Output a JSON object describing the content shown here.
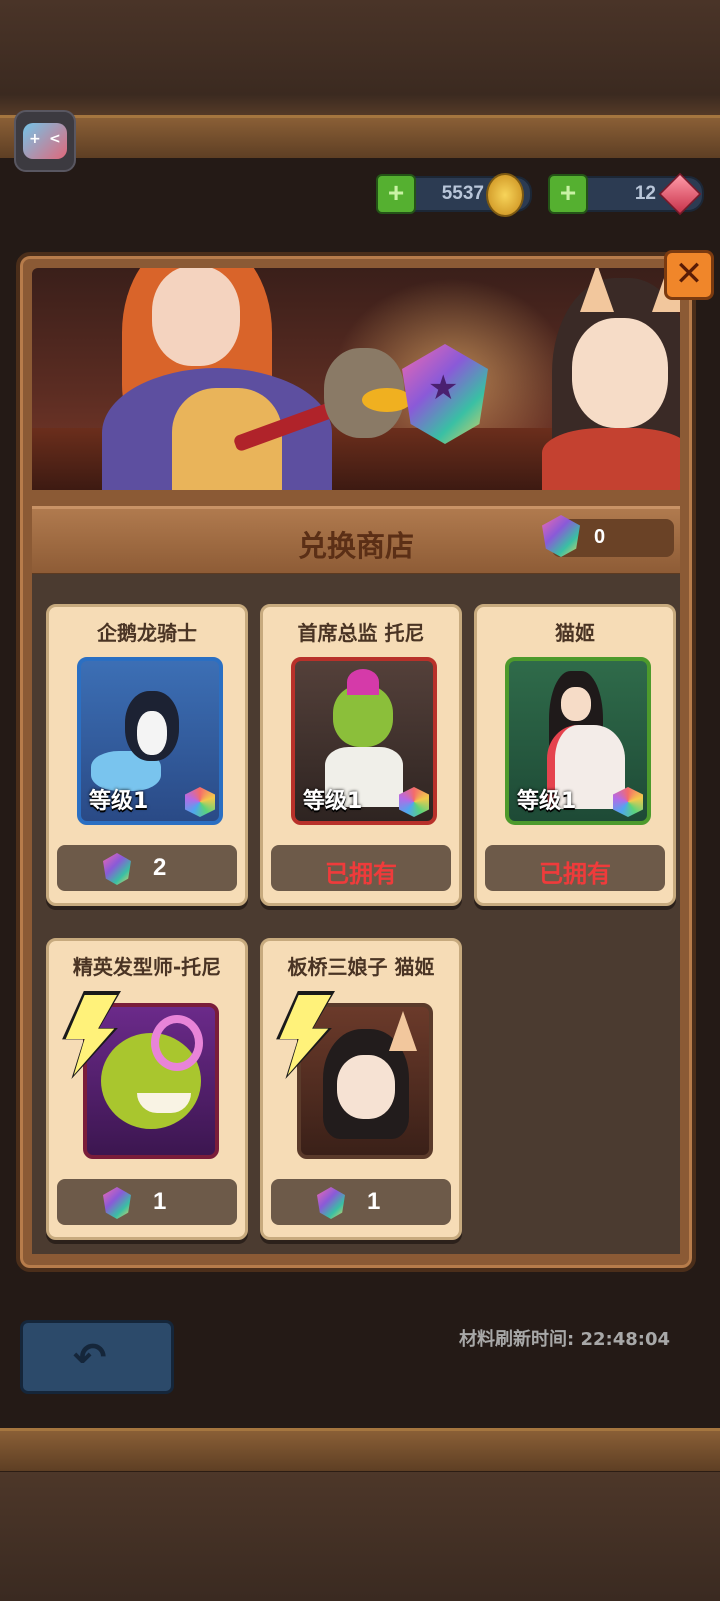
{
  "currency": {
    "gold": "5537",
    "gems": "12"
  },
  "shop": {
    "title": "兑换商店",
    "token_balance": "0"
  },
  "items": [
    {
      "name": "企鹅龙骑士",
      "level": "等级1",
      "cost": "2",
      "owned_label": ""
    },
    {
      "name": "首席总监 托尼",
      "level": "等级1",
      "cost": "",
      "owned_label": "已拥有"
    },
    {
      "name": "猫姬",
      "level": "等级1",
      "cost": "",
      "owned_label": "已拥有"
    },
    {
      "name": "精英发型师-托尼",
      "level": "",
      "cost": "1",
      "owned_label": ""
    },
    {
      "name": "板桥三娘子 猫姬",
      "level": "",
      "cost": "1",
      "owned_label": ""
    }
  ],
  "behind": {
    "refresh_time": "材料刷新时间: 22:48:04"
  }
}
